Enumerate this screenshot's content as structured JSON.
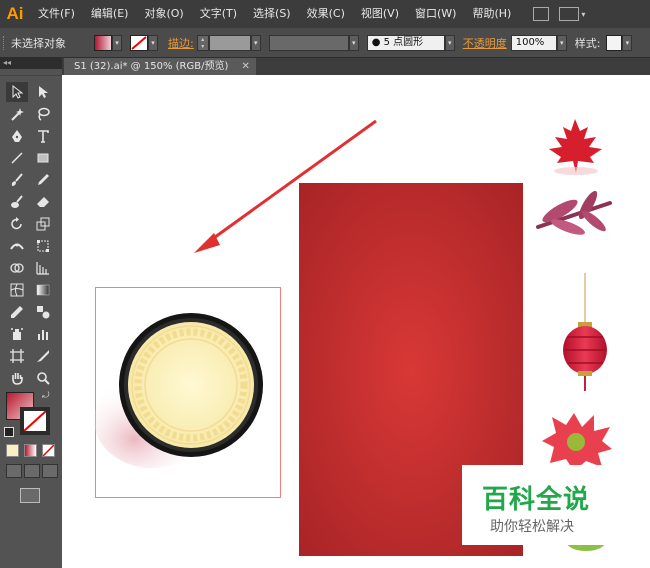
{
  "app": {
    "logo": "Ai"
  },
  "menu": [
    "文件(F)",
    "编辑(E)",
    "对象(O)",
    "文字(T)",
    "选择(S)",
    "效果(C)",
    "视图(V)",
    "窗口(W)",
    "帮助(H)"
  ],
  "control_bar": {
    "selection_label": "未选择对象",
    "stroke_label": "描边:",
    "brush_value": "5 点圆形",
    "opacity_label": "不透明度",
    "opacity_value": "100%",
    "style_label": "样式:"
  },
  "document_tab": {
    "title": "S1 (32).ai* @ 150% (RGB/预览)",
    "close": "✕"
  },
  "tool_panel": {
    "header": "◂◂"
  },
  "colors": {
    "accent": "#ff9a00",
    "fill_swatch": "#c8283a",
    "card_red": "#c9302c",
    "plate_cream": "#fef6c2",
    "arrow_red": "#e03030",
    "watermark_green": "#22a84a"
  },
  "watermark": {
    "title": "百科全说",
    "subtitle": "助你轻松解决"
  }
}
